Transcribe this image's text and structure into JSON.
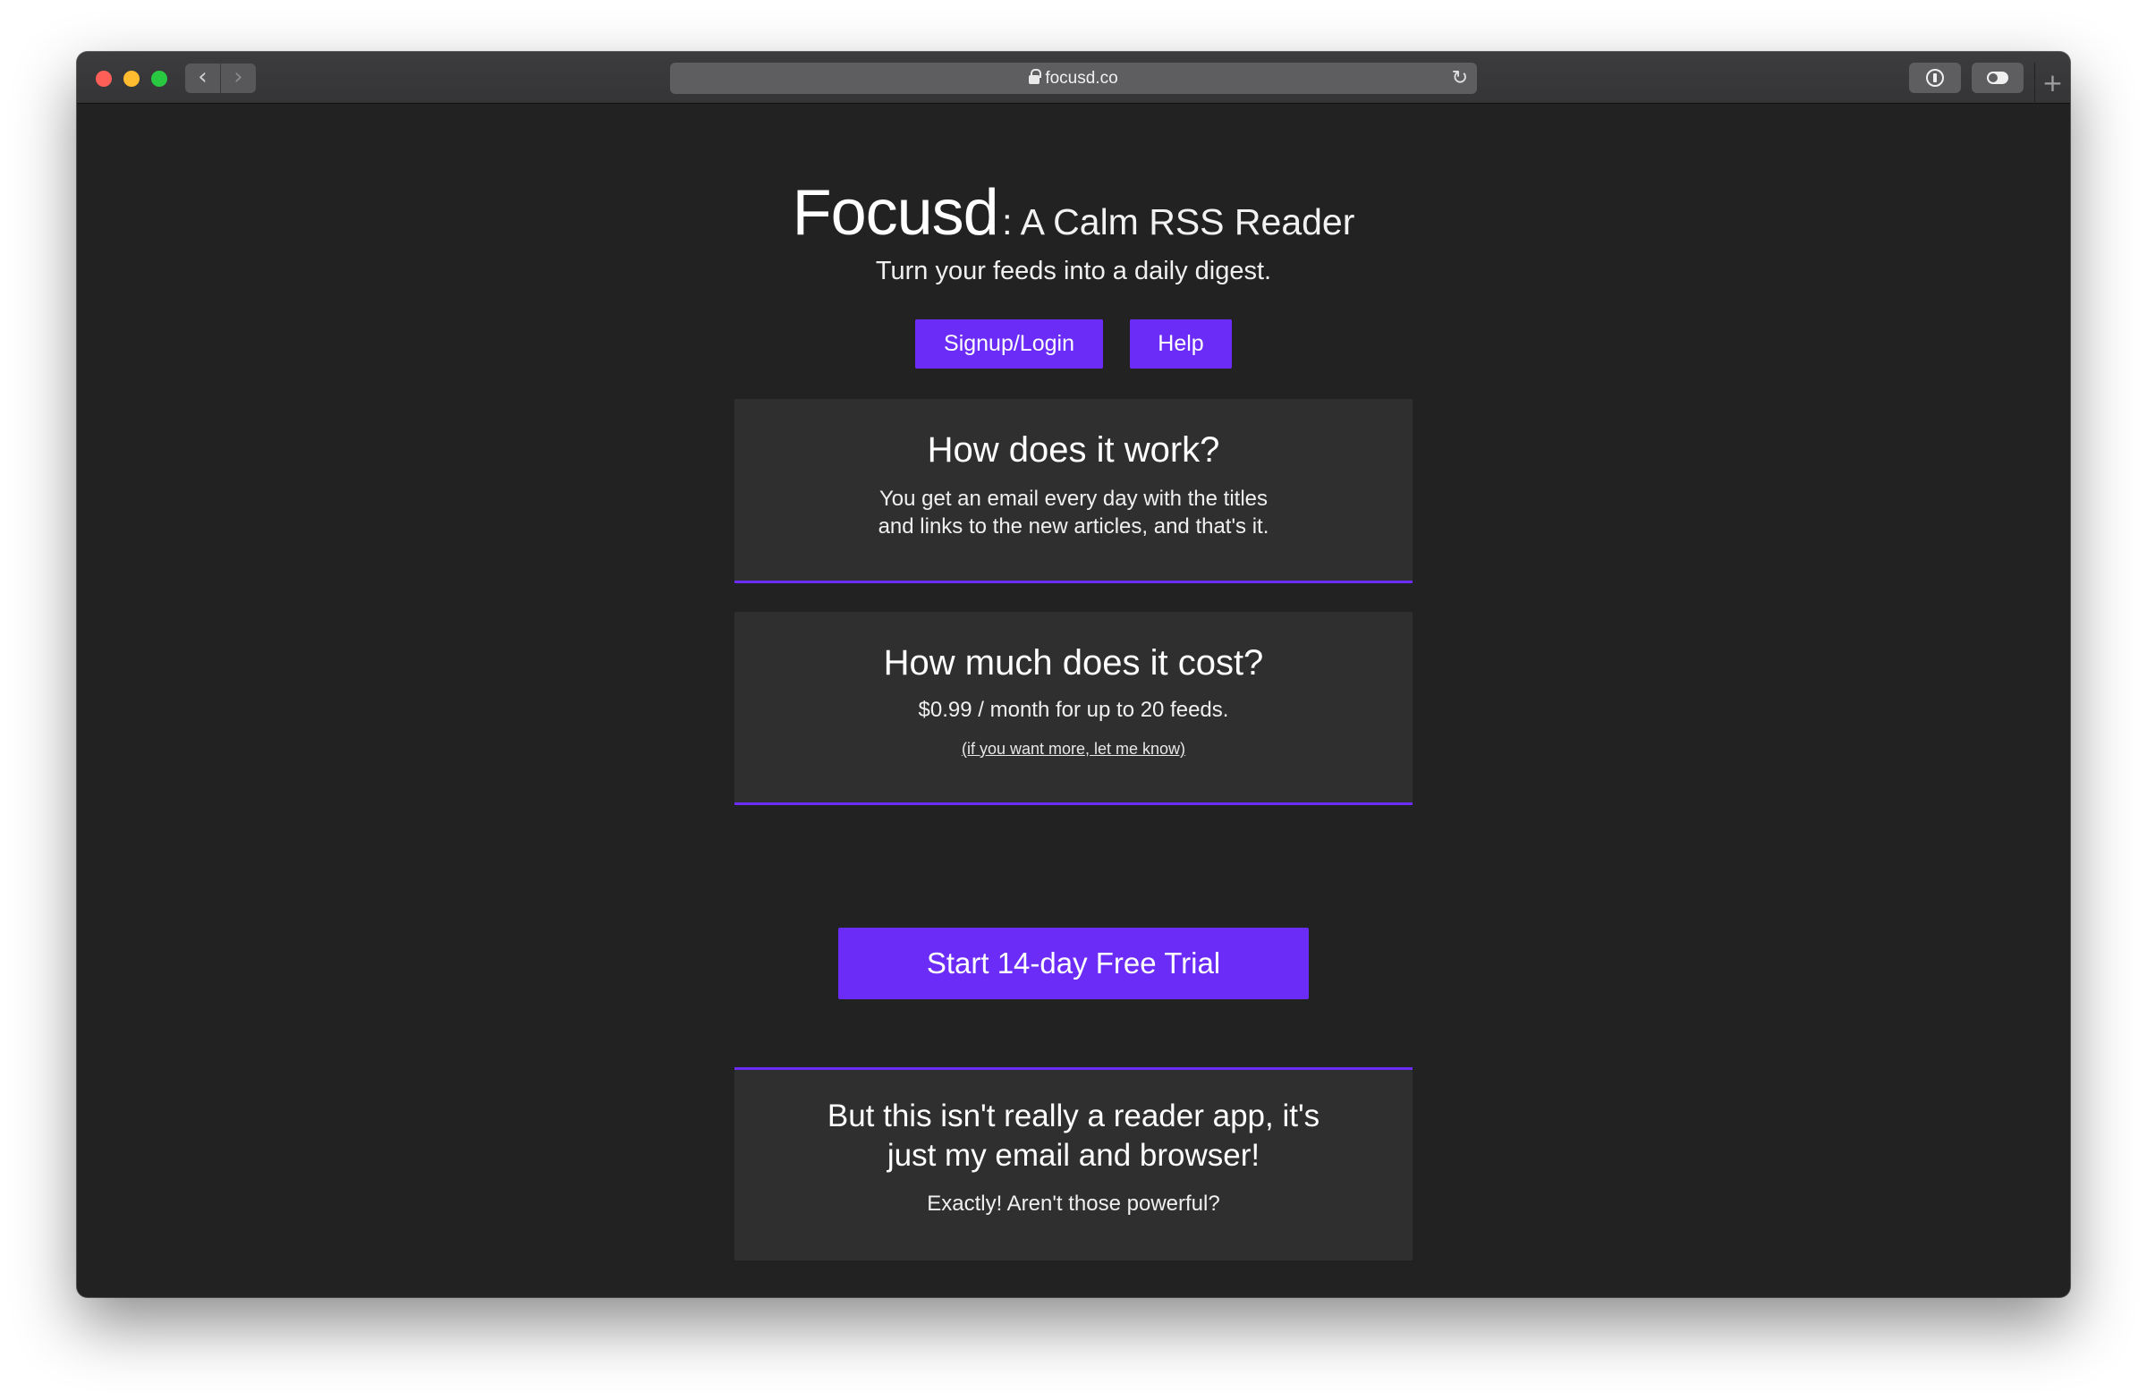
{
  "browser": {
    "url": "focusd.co",
    "back_icon": "‹",
    "forward_icon": "›",
    "reload_icon": "↻",
    "new_tab_icon": "+"
  },
  "hero": {
    "brand": "Focusd",
    "tagline": ": A Calm RSS Reader",
    "subtitle": "Turn your feeds into a daily digest.",
    "signup_label": "Signup/Login",
    "help_label": "Help"
  },
  "cards": {
    "how": {
      "title": "How does it work?",
      "line1": "You get an email every day with the titles",
      "line2": "and links to the new articles, and that's it."
    },
    "cost": {
      "title": "How much does it cost?",
      "body": "$0.99 / month for up to 20 feeds.",
      "note": "(if you want more, let me know)"
    },
    "reader": {
      "title_line1": "But this isn't really a reader app, it's",
      "title_line2": "just my email and browser!",
      "body": "Exactly! Aren't those powerful?"
    }
  },
  "cta": {
    "trial_label": "Start 14-day Free Trial"
  },
  "colors": {
    "accent": "#6b2cf7",
    "background": "#222223",
    "card": "#2f2f30"
  }
}
